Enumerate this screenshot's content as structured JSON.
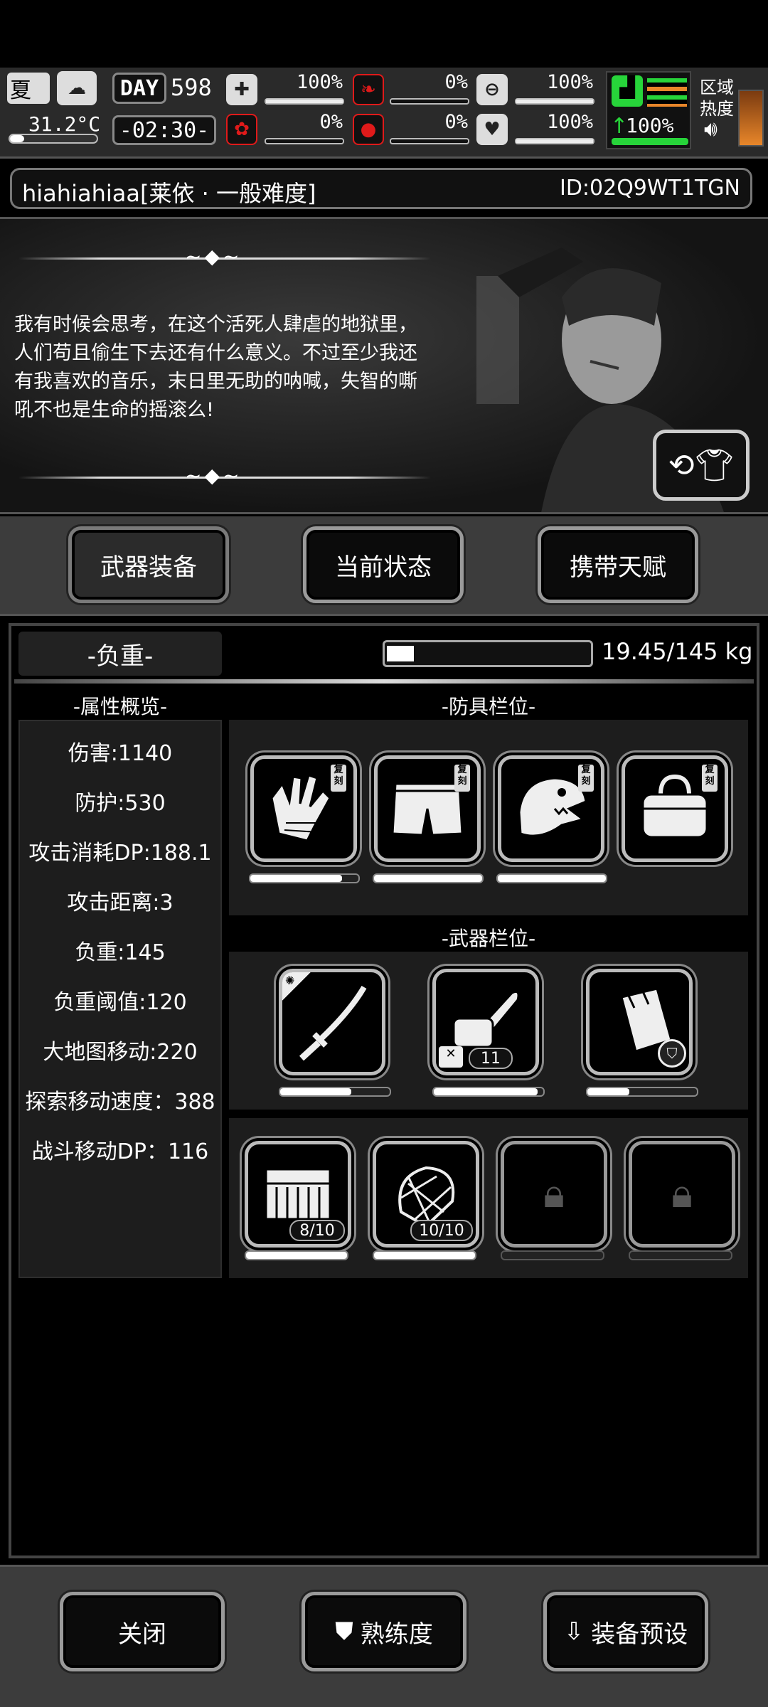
{
  "status": {
    "season": "夏",
    "temperature": "31.2°C",
    "day_label": "DAY",
    "day_value": "598",
    "time": "-02:30-",
    "health_pct": "100%",
    "hunger_pct": "0%",
    "stamina_pct": "100%",
    "sanity_pct": "0%",
    "blood_pct": "0%",
    "heart_pct": "100%",
    "fatigue_pct": "100%",
    "zone_label": "区域热度",
    "icons": [
      "sun-icon",
      "cloud-icon",
      "medkit-icon",
      "stomach-icon",
      "capsule-icon",
      "boot-icon",
      "brain-icon",
      "blood-drop-icon",
      "heart-icon",
      "speaker-icon"
    ]
  },
  "player": {
    "name": "hiahiahiaa[莱依 · 一般难度]",
    "id": "ID:02Q9WT1TGN"
  },
  "story": {
    "text": "我有时候会思考，在这个活死人肆虐的地狱里，人们苟且偷生下去还有什么意义。不过至少我还有我喜欢的音乐，末日里无助的呐喊，失智的嘶吼不也是生命的摇滚么!"
  },
  "tabs": [
    "武器装备",
    "当前状态",
    "携带天赋"
  ],
  "load": {
    "label": "-负重-",
    "text": "19.45/145 kg",
    "fraction": 0.134
  },
  "attributes": {
    "header": "-属性概览-",
    "items": [
      "伤害:1140",
      "防护:530",
      "攻击消耗DP:188.1",
      "攻击距离:3",
      "负重:145",
      "负重阈值:120",
      "大地图移动:220",
      "探索移动速度：388",
      "战斗移动DP：116"
    ]
  },
  "armor": {
    "header": "-防具栏位-",
    "tag": "复刻",
    "slots": [
      {
        "icon": "gloves-icon",
        "durability": 0.85
      },
      {
        "icon": "shorts-icon",
        "durability": 1.0
      },
      {
        "icon": "dino-mask-icon",
        "durability": 1.0
      },
      {
        "icon": "duffel-bag-icon"
      }
    ]
  },
  "weapons": {
    "header": "-武器栏位-",
    "slots": [
      {
        "icon": "katana-icon",
        "durability": 0.65
      },
      {
        "icon": "chainsaw-icon",
        "count": "11",
        "durability": 0.95
      },
      {
        "icon": "shield-case-icon",
        "durability": 0.38
      }
    ]
  },
  "items": {
    "slots": [
      {
        "icon": "crate-icon",
        "count": "8/10"
      },
      {
        "icon": "net-icon",
        "count": "10/10"
      },
      {
        "icon": "lock-icon"
      },
      {
        "icon": "lock-icon"
      }
    ]
  },
  "bottom": {
    "close": "关闭",
    "proficiency": "熟练度",
    "preset": "装备预设"
  },
  "colors": {
    "accent": "#e8862a",
    "green": "#27d43a",
    "red": "#e01a1a"
  }
}
